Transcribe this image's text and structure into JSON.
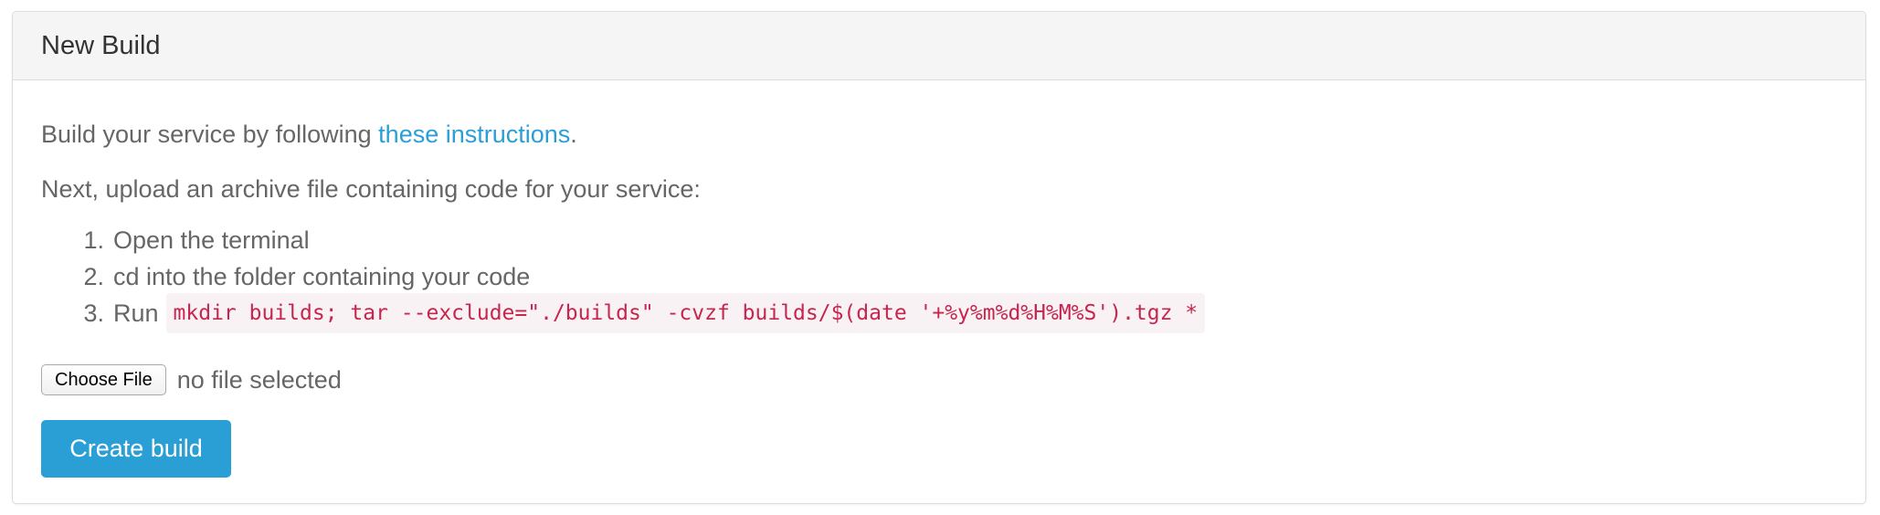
{
  "panel": {
    "title": "New Build"
  },
  "body": {
    "intro_prefix": "Build your service by following ",
    "intro_link": "these instructions",
    "intro_suffix": ".",
    "upload_text": "Next, upload an archive file containing code for your service:",
    "steps": [
      {
        "num": "1.",
        "text": "Open the terminal"
      },
      {
        "num": "2.",
        "text": "cd into the folder containing your code"
      },
      {
        "num": "3.",
        "text": "Run",
        "code": "mkdir builds; tar --exclude=\"./builds\" -cvzf builds/$(date '+%y%m%d%H%M%S').tgz *"
      }
    ]
  },
  "file_input": {
    "button_label": "Choose File",
    "status": "no file selected"
  },
  "actions": {
    "create_label": "Create build"
  },
  "colors": {
    "accent": "#2a9fd6",
    "code_text": "#c7254e",
    "code_bg": "#f9f2f4",
    "body_text": "#666666",
    "heading_bg": "#f5f5f5"
  }
}
